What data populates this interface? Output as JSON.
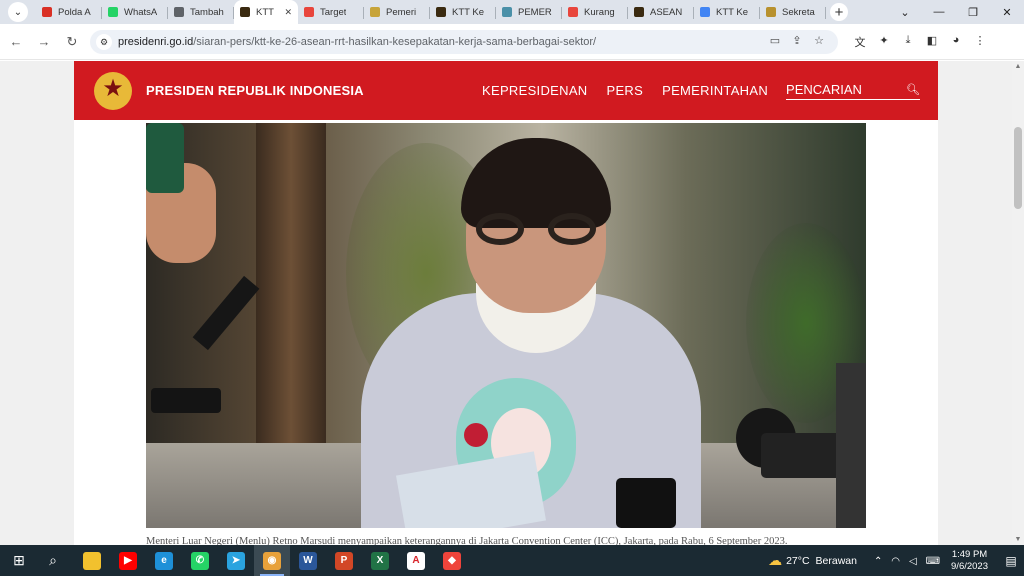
{
  "browser": {
    "tabs": [
      {
        "title": "Polda A",
        "favicon_color": "#d93025",
        "active": false
      },
      {
        "title": "WhatsA",
        "favicon_color": "#25d366",
        "active": false
      },
      {
        "title": "Tambah",
        "favicon_color": "#5f6368",
        "active": false
      },
      {
        "title": "KTT",
        "favicon_color": "#3a2a10",
        "active": true
      },
      {
        "title": "Target",
        "favicon_color": "#e8453c",
        "active": false
      },
      {
        "title": "Pemeri",
        "favicon_color": "#c7a43a",
        "active": false
      },
      {
        "title": "KTT Ke",
        "favicon_color": "#3a2a10",
        "active": false
      },
      {
        "title": "PEMER",
        "favicon_color": "#4a90a8",
        "active": false
      },
      {
        "title": "Kurang",
        "favicon_color": "#e8453c",
        "active": false
      },
      {
        "title": "ASEAN",
        "favicon_color": "#3a2a10",
        "active": false
      },
      {
        "title": "KTT Ke",
        "favicon_color": "#4285f4",
        "active": false
      },
      {
        "title": "Sekreta",
        "favicon_color": "#b8912e",
        "active": false
      }
    ],
    "url_domain": "presidenri.go.id",
    "url_path": "/siaran-pers/ktt-ke-26-asean-rrt-hasilkan-kesepakatan-kerja-sama-berbagai-sektor/"
  },
  "site": {
    "brand": "PRESIDEN REPUBLIK INDONESIA",
    "nav": [
      "KEPRESIDENAN",
      "PERS",
      "PEMERINTAHAN"
    ],
    "search_label": "PENCARIAN",
    "header_color": "#d11a20"
  },
  "article": {
    "caption": "Menteri Luar Negeri (Menlu) Retno Marsudi menyampaikan keterangannya di Jakarta Convention Center (ICC), Jakarta, pada Rabu, 6 September 2023."
  },
  "taskbar": {
    "apps": [
      {
        "name": "file-explorer",
        "color": "#f2c12e",
        "label": "",
        "active": false
      },
      {
        "name": "youtube",
        "color": "#ff0000",
        "label": "▶",
        "active": false
      },
      {
        "name": "edge",
        "color": "#1e90d8",
        "label": "e",
        "active": false
      },
      {
        "name": "whatsapp",
        "color": "#25d366",
        "label": "✆",
        "active": false
      },
      {
        "name": "telegram",
        "color": "#2aa3df",
        "label": "➤",
        "active": false
      },
      {
        "name": "chrome",
        "color": "#e8a13a",
        "label": "◉",
        "active": true
      },
      {
        "name": "word",
        "color": "#2b579a",
        "label": "W",
        "active": false
      },
      {
        "name": "powerpoint",
        "color": "#d24726",
        "label": "P",
        "active": false
      },
      {
        "name": "excel",
        "color": "#217346",
        "label": "X",
        "active": false
      },
      {
        "name": "acrobat",
        "color": "#ffffff",
        "label": "A",
        "active": false
      },
      {
        "name": "anydesk",
        "color": "#ef443b",
        "label": "◆",
        "active": false
      }
    ],
    "weather_temp": "27°C",
    "weather_desc": "Berawan",
    "time": "1:49 PM",
    "date": "9/6/2023"
  }
}
